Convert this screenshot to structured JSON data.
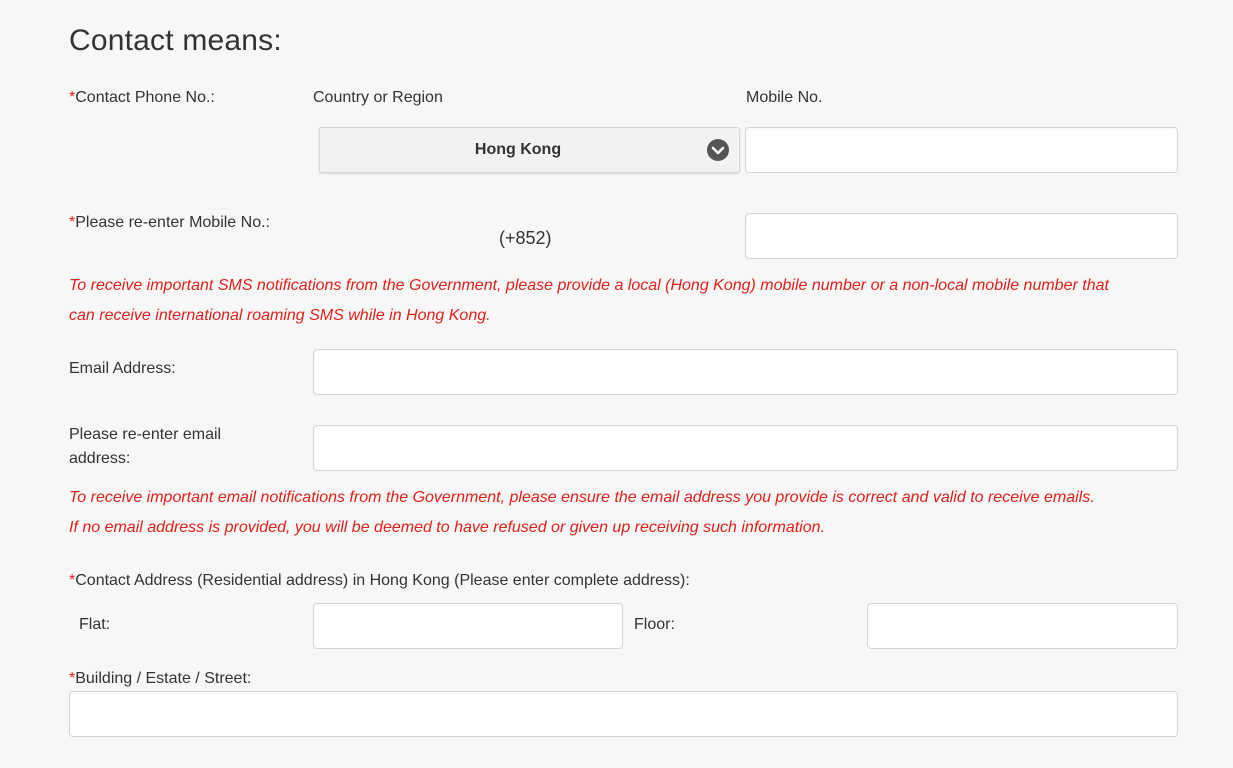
{
  "section_title": "Contact means:",
  "required_marker": "*",
  "phone": {
    "label": "Contact Phone No.:",
    "country_header": "Country or Region",
    "mobile_header": "Mobile No.",
    "country_selected": "Hong Kong",
    "mobile_value": "",
    "reenter_label": "Please re-enter Mobile No.:",
    "country_code": "(+852)",
    "reenter_value": ""
  },
  "sms_notice": {
    "line1": "To receive important SMS notifications from the Government, please provide a local (Hong Kong) mobile number or a non-local mobile number that",
    "line2": "can receive international roaming SMS while in Hong Kong."
  },
  "email": {
    "label": "Email Address:",
    "value": "",
    "reenter_label_line1": "Please re-enter email",
    "reenter_label_line2": "address:",
    "reenter_value": ""
  },
  "email_notice": {
    "line1": "To receive important email notifications from the Government, please ensure the email address you provide is correct and valid to receive emails.",
    "line2": "If no email address is provided, you will be deemed to have refused or given up receiving such information."
  },
  "address": {
    "label": "Contact Address (Residential address) in Hong Kong (Please enter complete address):",
    "flat_label": "Flat:",
    "floor_label": "Floor:",
    "building_label": "Building / Estate / Street:",
    "flat_value": "",
    "floor_value": "",
    "building_value": ""
  },
  "icons": {
    "dropdown": "chevron-down-circle-icon"
  },
  "colors": {
    "required": "#e0201b",
    "notice": "#e0201b",
    "background": "#f7f7f7"
  }
}
